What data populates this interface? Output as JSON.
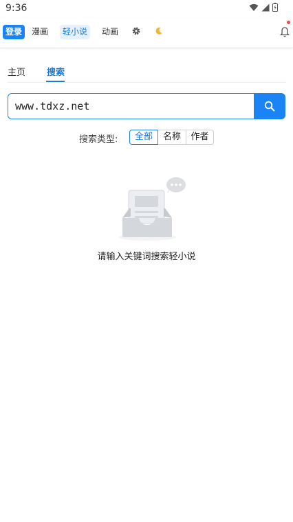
{
  "status_bar": {
    "time": "9:36"
  },
  "nav": {
    "login": "登录",
    "manga": "漫画",
    "light_novel": "轻小说",
    "anime": "动画"
  },
  "tabs": {
    "home": "主页",
    "search": "搜索"
  },
  "search": {
    "value": "www.tdxz.net"
  },
  "filter": {
    "label": "搜索类型:",
    "options": [
      "全部",
      "名称",
      "作者"
    ],
    "selected": "全部"
  },
  "empty": {
    "message": "请输入关键词搜索轻小说"
  },
  "colors": {
    "accent": "#1a84f5",
    "badge": "#f04646"
  },
  "icons": {
    "settings": "gear-icon",
    "theme": "moon-icon",
    "notifications": "bell-icon",
    "search": "search-icon"
  }
}
